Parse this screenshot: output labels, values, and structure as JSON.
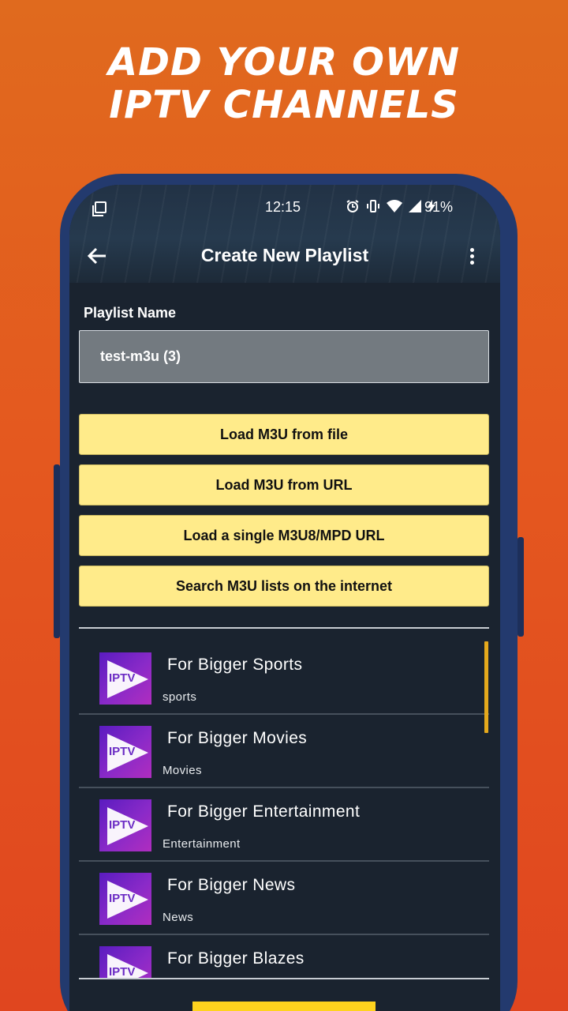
{
  "promo": {
    "line1": "ADD YOUR OWN",
    "line2": "IPTV CHANNELS"
  },
  "status_bar": {
    "time": "12:15",
    "battery": "91%"
  },
  "toolbar": {
    "title": "Create New Playlist"
  },
  "form": {
    "label": "Playlist Name",
    "value": "test-m3u (3)"
  },
  "buttons": [
    {
      "label": "Load M3U from file"
    },
    {
      "label": "Load M3U from URL"
    },
    {
      "label": "Load a single M3U8/MPD URL"
    },
    {
      "label": "Search M3U lists on the internet"
    }
  ],
  "channels": [
    {
      "name": "For Bigger Sports",
      "category": "sports",
      "logo_text": "IPTV"
    },
    {
      "name": "For Bigger Movies",
      "category": "Movies",
      "logo_text": "IPTV"
    },
    {
      "name": "For Bigger Entertainment",
      "category": "Entertainment",
      "logo_text": "IPTV"
    },
    {
      "name": "For Bigger News",
      "category": "News",
      "logo_text": "IPTV"
    },
    {
      "name": "For Bigger Blazes",
      "category": "",
      "logo_text": "IPTV"
    }
  ],
  "colors": {
    "accent": "#ffeb8a",
    "background": "#1a232f",
    "scrollbar": "#e5a91c",
    "fab": "#ffd31e"
  }
}
